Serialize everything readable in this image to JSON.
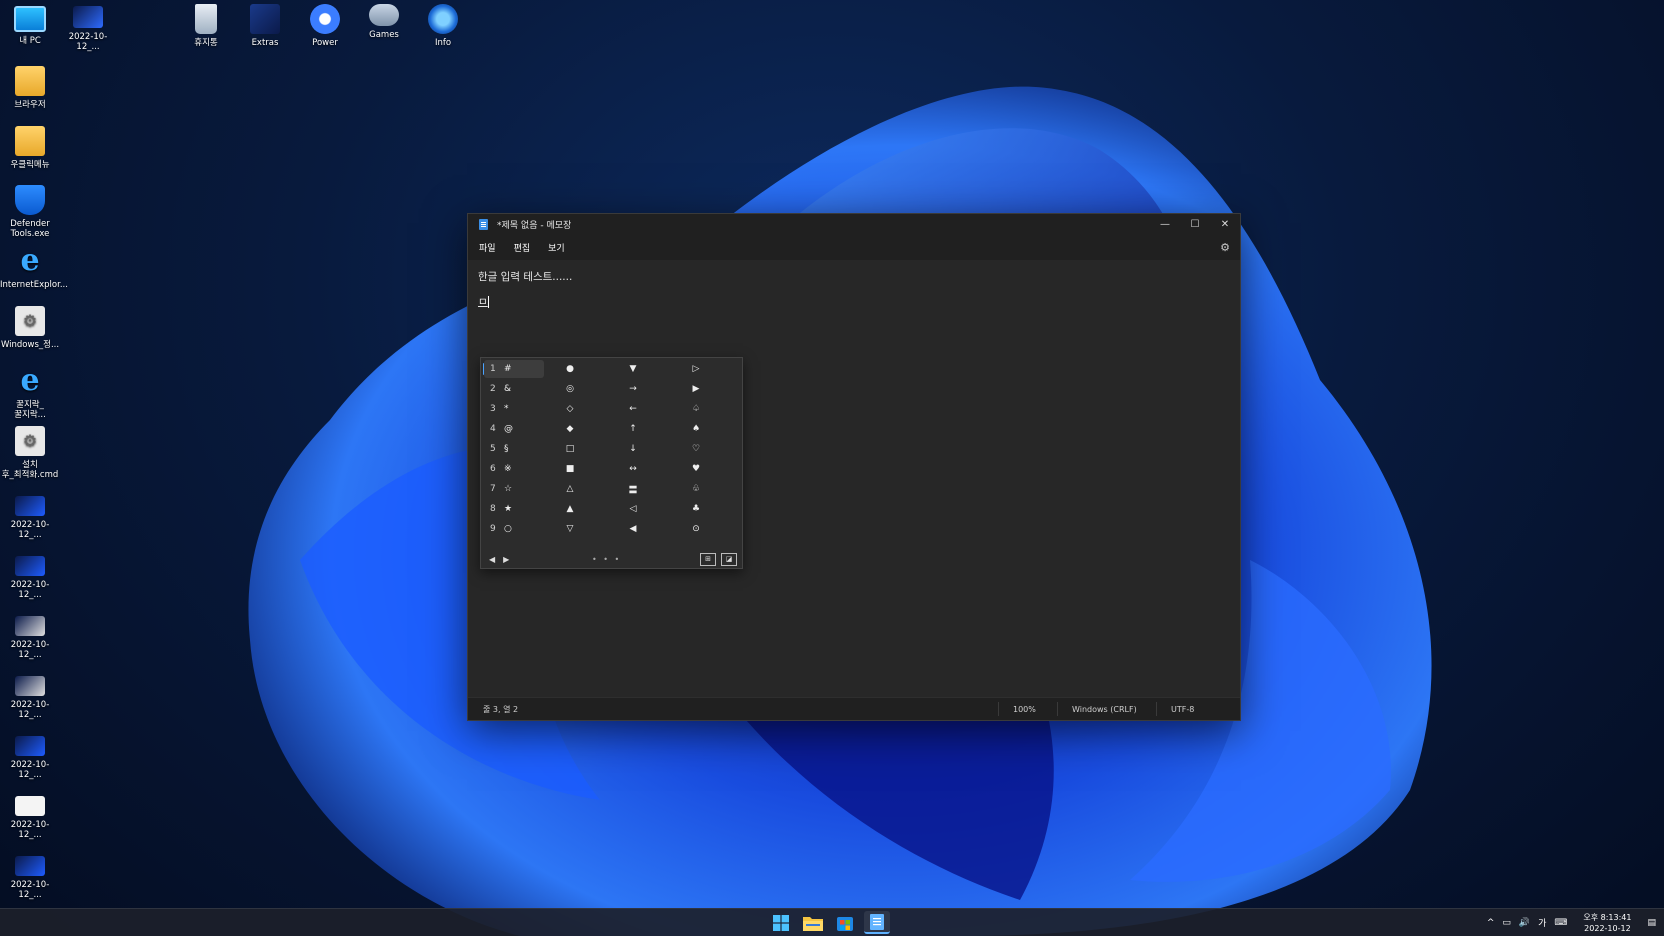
{
  "desktop": {
    "left_icons": [
      {
        "label": "내 PC",
        "icon": "monitor-icon"
      },
      {
        "label": "브라우저",
        "icon": "folder-icon"
      },
      {
        "label": "우클릭메뉴",
        "icon": "folder-icon"
      },
      {
        "label": "Defender\nTools.exe",
        "icon": "shield-icon"
      },
      {
        "label": "InternetExplor...",
        "icon": "ie-icon"
      },
      {
        "label": "Windows_정...",
        "icon": "settings-file-icon"
      },
      {
        "label": "꿀지락_\n꿀지락...",
        "icon": "ie-icon"
      },
      {
        "label": "설치\n후_최적화.cmd",
        "icon": "settings-file-icon"
      },
      {
        "label": "2022-10-12_...",
        "icon": "screenshot-icon"
      },
      {
        "label": "2022-10-12_...",
        "icon": "screenshot-icon"
      },
      {
        "label": "2022-10-12_...",
        "icon": "screenshot-icon"
      },
      {
        "label": "2022-10-12_...",
        "icon": "screenshot-icon"
      },
      {
        "label": "2022-10-12_...",
        "icon": "screenshot-icon"
      },
      {
        "label": "2022-10-12_...",
        "icon": "screenshot-icon"
      },
      {
        "label": "2022-10-12_...",
        "icon": "screenshot-icon"
      }
    ],
    "top_icons": [
      {
        "label": "2022-10-12_...",
        "icon": "screenshot-icon"
      },
      {
        "label": "휴지통",
        "icon": "recycle-bin-icon"
      },
      {
        "label": "Extras",
        "icon": "extras-icon"
      },
      {
        "label": "Power",
        "icon": "power-icon"
      },
      {
        "label": "Games",
        "icon": "gamepad-icon"
      },
      {
        "label": "Info",
        "icon": "info-icon"
      }
    ]
  },
  "notepad": {
    "title": "*제목 없음 - 메모장",
    "menu": [
      "파일",
      "편집",
      "보기"
    ],
    "line1": "한글 입력 테스트......",
    "line3": "ㅁ",
    "status": {
      "position": "줄 3, 열 2",
      "zoom": "100%",
      "line_ending": "Windows (CRLF)",
      "encoding": "UTF-8"
    }
  },
  "ime_candidates": {
    "rows": [
      {
        "num": "1",
        "cols": [
          "#",
          "●",
          "▼",
          "▷"
        ]
      },
      {
        "num": "2",
        "cols": [
          "&",
          "◎",
          "→",
          "▶"
        ]
      },
      {
        "num": "3",
        "cols": [
          "*",
          "◇",
          "←",
          "♤"
        ]
      },
      {
        "num": "4",
        "cols": [
          "@",
          "◆",
          "↑",
          "♠"
        ]
      },
      {
        "num": "5",
        "cols": [
          "§",
          "□",
          "↓",
          "♡"
        ]
      },
      {
        "num": "6",
        "cols": [
          "※",
          "■",
          "↔",
          "♥"
        ]
      },
      {
        "num": "7",
        "cols": [
          "☆",
          "△",
          "〓",
          "♧"
        ]
      },
      {
        "num": "8",
        "cols": [
          "★",
          "▲",
          "◁",
          "♣"
        ]
      },
      {
        "num": "9",
        "cols": [
          "○",
          "▽",
          "◀",
          "⊙"
        ]
      }
    ],
    "selected_index": 0,
    "prev": "◀",
    "next": "▶",
    "dots": "• • •"
  },
  "taskbar": {
    "apps": [
      "start-icon",
      "file-explorer-icon",
      "store-icon",
      "notepad-icon"
    ],
    "tray": {
      "chevron": "^",
      "ime_mode": "가",
      "time": "오후 8:13:41",
      "date": "2022-10-12"
    }
  },
  "colors": {
    "accent": "#4aa3ff",
    "window_bg": "#272727",
    "titlebar_bg": "#202020"
  }
}
